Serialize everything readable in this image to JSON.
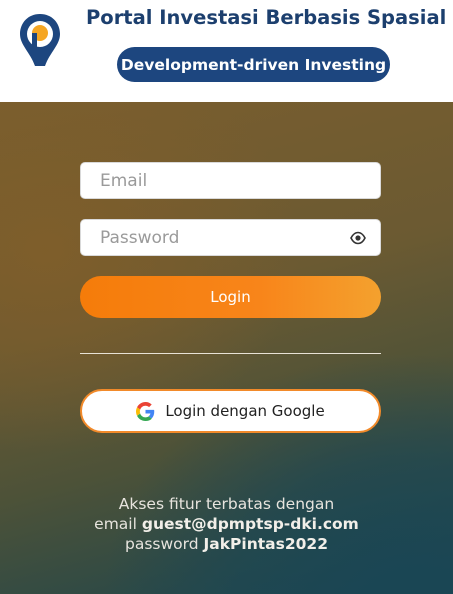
{
  "header": {
    "title": "Portal Investasi Berbasis Spasial",
    "tagline": "Development-driven Investing",
    "logo_icon": "map-pin-logo-icon",
    "colors": {
      "title": "#1c3f6e",
      "pill": "#1d467f",
      "logo_accent": "#f5a623"
    }
  },
  "form": {
    "email_placeholder": "Email",
    "password_placeholder": "Password",
    "password_toggle_icon": "eye-icon",
    "login_label": "Login",
    "google_label": "Login dengan Google",
    "google_icon": "google-g-icon"
  },
  "info": {
    "line1": "Akses fitur terbatas dengan",
    "email_prefix": "email",
    "email_value": "guest@dpmptsp-dki.com",
    "password_prefix": "password",
    "password_value": "JakPintas2022"
  },
  "colors": {
    "login_button": "#f57c0a",
    "google_border": "#f28a2a"
  }
}
